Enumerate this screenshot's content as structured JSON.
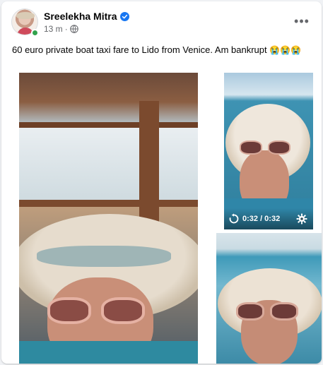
{
  "post": {
    "author": "Sreelekha Mitra",
    "time": "13 m",
    "separator": "·",
    "text": "60 euro private boat taxi fare to Lido from Venice. Am bankrupt",
    "emojis": "😭😭😭",
    "more_label": "•••"
  },
  "media": {
    "video_time": "0:32 / 0:32"
  },
  "colors": {
    "verified": "#1877f2",
    "online": "#31a24c",
    "meta_text": "#65676b"
  },
  "icons": [
    "verified-badge-icon",
    "globe-icon",
    "more-options-icon",
    "replay-icon",
    "settings-icon"
  ]
}
